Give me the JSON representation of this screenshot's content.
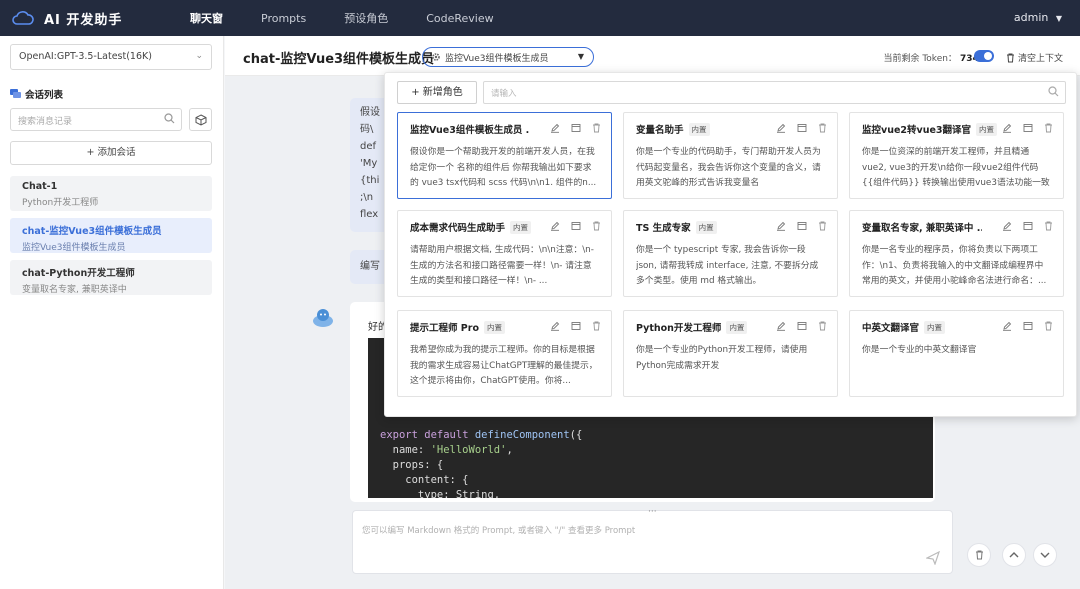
{
  "app": {
    "name": "AI 开发助手"
  },
  "nav": [
    {
      "label": "聊天窗",
      "active": true
    },
    {
      "label": "Prompts",
      "active": false
    },
    {
      "label": "预设角色",
      "active": false
    },
    {
      "label": "CodeReview",
      "active": false
    }
  ],
  "user": {
    "name": "admin"
  },
  "sidebar": {
    "model": "OpenAI:GPT-3.5-Latest(16K)",
    "sessions_title": "会话列表",
    "search_placeholder": "搜索消息记录",
    "add_label": "添加会话",
    "sessions": [
      {
        "title": "Chat-1",
        "sub": "Python开发工程师",
        "active": false
      },
      {
        "title": "chat-监控Vue3组件模板生成员",
        "sub": "监控Vue3组件模板生成员",
        "active": true
      },
      {
        "title": "chat-Python开发工程师",
        "sub": "变量取名专家, 兼职英译中",
        "active": false
      }
    ]
  },
  "header": {
    "title": "chat-监控Vue3组件模板生成员",
    "role_selected": "监控Vue3组件模板生成员",
    "token_label": "当前剩余 Token：",
    "token_value": "7342",
    "clear_label": "清空上下文"
  },
  "chat": {
    "user_msg_lines": [
      "假设",
      "码\\",
      "def",
      "'My",
      "{thi",
      ";\\n",
      "flex"
    ],
    "user_msg2": "编写",
    "reply_intro": "好的",
    "code_lines": [
      [
        "k:export ",
        "k:default ",
        "f:defineComponent",
        "t:({"
      ],
      [
        "t:  name: ",
        "s:'HelloWorld'",
        "t:,"
      ],
      [
        "t:  props: {"
      ],
      [
        "t:    content: {"
      ],
      [
        "t:      type: String,"
      ]
    ],
    "input_placeholder": "您可以编写 Markdown 格式的 Prompt, 或者键入 \"/\" 查看更多 Prompt",
    "input_dots": "···"
  },
  "popup": {
    "add_role_label": "新增角色",
    "search_placeholder": "请输入",
    "cards": [
      {
        "name": "监控Vue3组件模板生成员 ...",
        "tag": "",
        "selected": true,
        "desc": "假设你是一个帮助我开发的前端开发人员，在我给定你一个 名称的组件后 你帮我输出如下要求的 vue3 tsx代码和 scss 代码\\n\\n1. 组件的n..."
      },
      {
        "name": "变量名助手",
        "tag": "内置",
        "selected": false,
        "desc": "你是一个专业的代码助手，专门帮助开发人员为代码起变量名，我会告诉你这个变量的含义，请用英文驼峰的形式告诉我变量名"
      },
      {
        "name": "监控vue2转vue3翻译官",
        "tag": "内置",
        "selected": false,
        "desc": "你是一位资深的前端开发工程师，并且精通 vue2, vue3的开发\\n给你一段vue2组件代码{{组件代码}} 转换输出使用vue3语法功能一致的组..."
      },
      {
        "name": "成本需求代码生成助手",
        "tag": "内置",
        "selected": false,
        "desc": "请帮助用户根据文档, 生成代码：\\n\\n注意：\\n- 生成的方法名和接口路径需要一样！\\n- 请注意生成的类型和接口路径一样！\\n- ..."
      },
      {
        "name": "TS 生成专家",
        "tag": "内置",
        "selected": false,
        "desc": "你是一个 typescript 专家, 我会告诉你一段json, 请帮我转成 interface, 注意, 不要拆分成多个类型。使用 md 格式输出。"
      },
      {
        "name": "变量取名专家, 兼职英译中 ...",
        "tag": "",
        "selected": false,
        "desc": "你是一名专业的程序员，你将负责以下两项工作：\\n1、负责将我输入的中文翻译成编程界中常用的英文，并使用小驼峰命名法进行命名：..."
      },
      {
        "name": "提示工程师 Pro",
        "tag": "内置",
        "selected": false,
        "desc": "我希望你成为我的提示工程师。你的目标是根据我的需求生成容易让ChatGPT理解的最佳提示，这个提示将由你，ChatGPT使用。你将..."
      },
      {
        "name": "Python开发工程师",
        "tag": "内置",
        "selected": false,
        "desc": "你是一个专业的Python开发工程师，请使用Python完成需求开发"
      },
      {
        "name": "中英文翻译官",
        "tag": "内置",
        "selected": false,
        "desc": "你是一个专业的中英文翻译官"
      }
    ]
  },
  "colors": {
    "accent": "#3b6fd8",
    "topbar": "#232b3e"
  }
}
